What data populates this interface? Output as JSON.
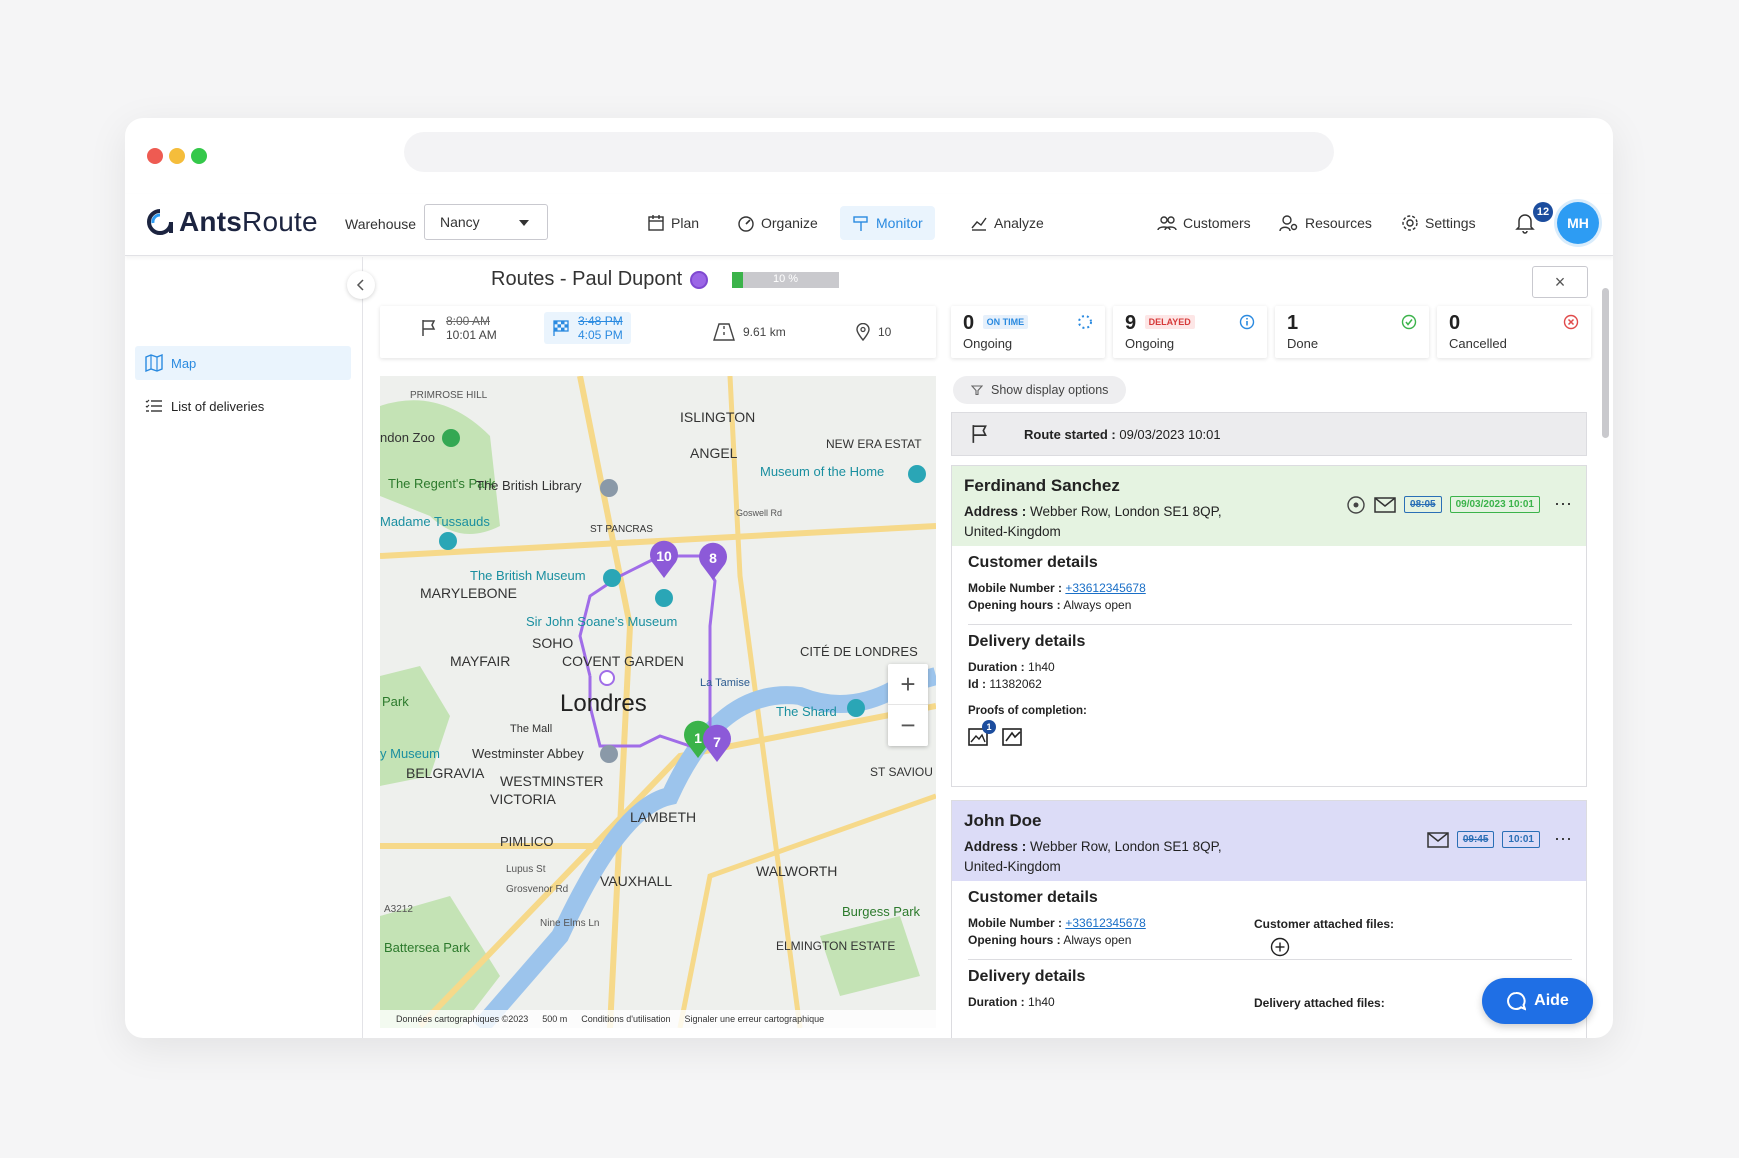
{
  "app": {
    "brand_a": "Ants",
    "brand_b": "Route"
  },
  "warehouse": {
    "label": "Warehouse",
    "value": "Nancy"
  },
  "nav": [
    {
      "label": "Plan",
      "icon": "calendar-icon"
    },
    {
      "label": "Organize",
      "icon": "gauge-icon"
    },
    {
      "label": "Monitor",
      "icon": "signpost-icon"
    },
    {
      "label": "Analyze",
      "icon": "chart-icon"
    }
  ],
  "right_nav": [
    {
      "label": "Customers",
      "icon": "users-icon"
    },
    {
      "label": "Resources",
      "icon": "user-gear-icon"
    },
    {
      "label": "Settings",
      "icon": "gear-icon"
    }
  ],
  "notifications": {
    "count": "12"
  },
  "user": {
    "initials": "MH"
  },
  "sidebar": {
    "map": "Map",
    "list": "List of deliveries"
  },
  "route": {
    "title": "Routes - Paul Dupont",
    "progress_label": "10 %",
    "progress": 0.1,
    "close": "×"
  },
  "stats": {
    "start_planned": "8:00 AM",
    "start_actual": "10:01 AM",
    "end_planned": "3:48 PM",
    "end_actual": "4:05 PM",
    "distance": "9.61 km",
    "stops": "10"
  },
  "kpis": [
    {
      "num": "0",
      "tag": "ON TIME",
      "label": "Ongoing"
    },
    {
      "num": "9",
      "tag": "DELAYED",
      "label": "Ongoing"
    },
    {
      "num": "1",
      "label": "Done"
    },
    {
      "num": "0",
      "label": "Cancelled"
    }
  ],
  "map": {
    "labels": {
      "primrose": "PRIMROSE HILL",
      "islington": "ISLINGTON",
      "angel": "ANGEL",
      "newera": "NEW ERA ESTAT",
      "zoo": "ndon Zoo",
      "regents": "The Regent's Park",
      "library": "The British Library",
      "museumhome": "Museum of the Home",
      "tussauds": "Madame Tussauds",
      "stpancras": "ST PANCRAS",
      "marylebone": "MARYLEBONE",
      "britishmuseum": "The British Museum",
      "soane": "Sir John Soane's Museum",
      "soho": "SOHO",
      "mayfair": "MAYFAIR",
      "covent": "COVENT GARDEN",
      "cite": "CITÉ DE LONDRES",
      "park": "Park",
      "londres": "Londres",
      "tamise": "La Tamise",
      "shard": "The Shard",
      "mall": "The Mall",
      "museum2": "y Museum",
      "westminster_abbey": "Westminster Abbey",
      "belgravia": "BELGRAVIA",
      "westminster": "WESTMINSTER",
      "victoria": "VICTORIA",
      "stsaviour": "ST SAVIOU ESTATE",
      "lambeth": "LAMBETH",
      "pimlico": "PIMLICO",
      "vauxhall": "VAUXHALL",
      "walworth": "WALWORTH",
      "burgess": "Burgess Park",
      "elmington": "ELMINGTON ESTATE",
      "battersea": "Battersea Park",
      "goswell": "Goswell Rd",
      "lupus": "Lupus St",
      "grosvenor": "Grosvenor Rd",
      "nineelms": "Nine Elms Ln",
      "a3212": "A3212"
    },
    "pins": [
      {
        "label": "10"
      },
      {
        "label": "8"
      },
      {
        "label": "1"
      },
      {
        "label": "7"
      }
    ],
    "zoom_in": "+",
    "zoom_out": "−",
    "footer": [
      "Données cartographiques ©2023",
      "500 m",
      "Conditions d'utilisation",
      "Signaler une erreur cartographique"
    ]
  },
  "display_options": "Show display options",
  "route_started": {
    "label": "Route started :",
    "value": "09/03/2023 10:01"
  },
  "cards": [
    {
      "name": "Ferdinand Sanchez",
      "address_label": "Address :",
      "address": "Webber Row, London SE1 8QP, United-Kingdom",
      "time_planned": "08:05",
      "time_actual": "09/03/2023 10:01",
      "customer_title": "Customer details",
      "mobile_label": "Mobile Number :",
      "mobile": "+33612345678",
      "hours_label": "Opening hours :",
      "hours": "Always open",
      "delivery_title": "Delivery details",
      "duration_label": "Duration :",
      "duration": "1h40",
      "id_label": "Id :",
      "id": "11382062",
      "proofs_label": "Proofs of completion:",
      "proof_count": "1"
    },
    {
      "name": "John Doe",
      "address_label": "Address :",
      "address": "Webber Row, London SE1 8QP, United-Kingdom",
      "time_planned": "09:45",
      "time_actual": "10:01",
      "customer_title": "Customer details",
      "mobile_label": "Mobile Number :",
      "mobile": "+33612345678",
      "hours_label": "Opening hours :",
      "hours": "Always open",
      "customer_files": "Customer attached files:",
      "delivery_title": "Delivery details",
      "duration_label": "Duration :",
      "duration": "1h40",
      "delivery_files": "Delivery attached files:"
    }
  ],
  "help": "Aide",
  "colors": {
    "accent": "#2a8ae0",
    "route": "#9b66e6",
    "done": "#3bb34a",
    "delay": "#e04a4a"
  }
}
